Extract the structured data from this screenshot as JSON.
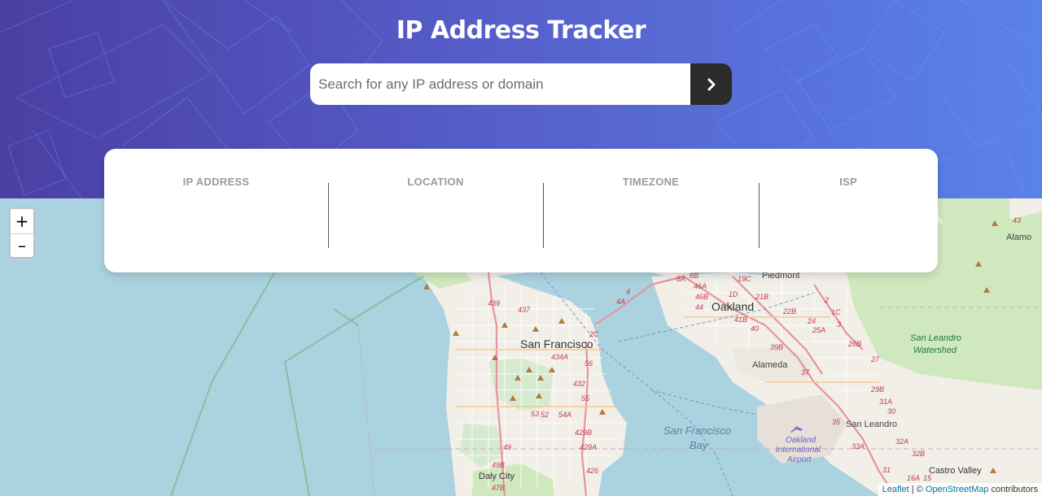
{
  "header": {
    "title": "IP Address Tracker",
    "search_placeholder": "Search for any IP address or domain",
    "search_value": "",
    "submit_icon": "chevron-right-icon"
  },
  "info": {
    "columns": [
      {
        "label": "IP ADDRESS",
        "value": ""
      },
      {
        "label": "LOCATION",
        "value": ""
      },
      {
        "label": "TIMEZONE",
        "value": ""
      },
      {
        "label": "ISP",
        "value": ""
      }
    ]
  },
  "map": {
    "zoom_in": "+",
    "zoom_out": "–",
    "labels": {
      "san_francisco": "San Francisco",
      "oakland": "Oakland",
      "piedmont": "Piedmont",
      "alameda": "Alameda",
      "alamo": "Alamo",
      "san_leandro": "San Leandro",
      "san_leandro_watershed_1": "San Leandro",
      "san_leandro_watershed_2": "Watershed",
      "sf_bay_1": "San Francisco",
      "sf_bay_2": "Bay",
      "airport_1": "Oakland",
      "airport_2": "International",
      "airport_3": "Airport",
      "daly_city": "Daly City",
      "castro_valley": "Castro Valley"
    },
    "route_labels": [
      "439",
      "437",
      "2C",
      "434A",
      "56",
      "432",
      "55",
      "53",
      "52",
      "54A",
      "429B",
      "49",
      "429A",
      "49B",
      "426",
      "47B",
      "4A",
      "4",
      "8A",
      "8B",
      "46A",
      "46B",
      "44",
      "1D",
      "19C",
      "21B",
      "22B",
      "41B",
      "40",
      "39B",
      "37",
      "24",
      "25A",
      "26B",
      "27",
      "2",
      "1C",
      "3",
      "29B",
      "31A",
      "30",
      "35",
      "32A",
      "33A",
      "32B",
      "31",
      "16A",
      "15",
      "43"
    ],
    "attribution": {
      "leaflet": "Leaflet",
      "separator": " | © ",
      "osm": "OpenStreetMap",
      "suffix": " contributors"
    }
  },
  "colors": {
    "header_start": "#4b3fa3",
    "header_end": "#5a82e8",
    "water": "#aad3df",
    "land": "#f2efe9",
    "park": "#cfe8bd",
    "highway": "#e8929e",
    "button_dark": "#2b2b2b"
  }
}
